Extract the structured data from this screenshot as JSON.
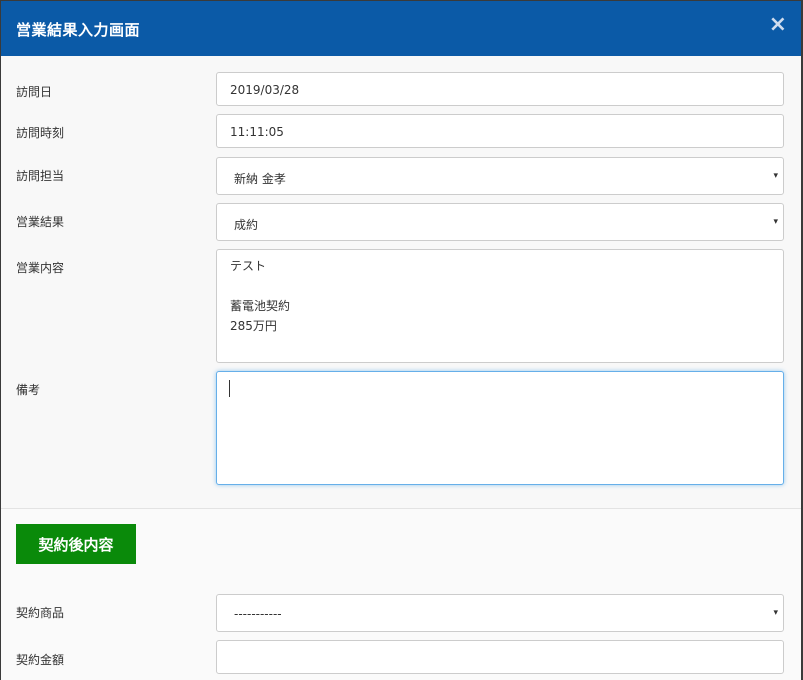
{
  "modal": {
    "title": "営業結果入力画面",
    "close_symbol": "×"
  },
  "form": {
    "visit_date": {
      "label": "訪問日",
      "value": "2019/03/28"
    },
    "visit_time": {
      "label": "訪問時刻",
      "value": "11:11:05"
    },
    "visit_staff": {
      "label": "訪問担当",
      "value": "新納 金孝"
    },
    "sales_result": {
      "label": "営業結果",
      "value": "成約"
    },
    "sales_content": {
      "label": "営業内容",
      "value": "テスト\n\n蓄電池契約\n285万円"
    },
    "remarks": {
      "label": "備考",
      "value": ""
    }
  },
  "contract_section": {
    "button_label": "契約後内容",
    "product": {
      "label": "契約商品",
      "value": "-----------"
    },
    "amount": {
      "label": "契約金額",
      "value": ""
    }
  },
  "icons": {
    "select_arrow": "▾"
  },
  "colors": {
    "header": "#0b5aa7",
    "green_button": "#0a8a0a",
    "focus_border": "#66afe9"
  }
}
